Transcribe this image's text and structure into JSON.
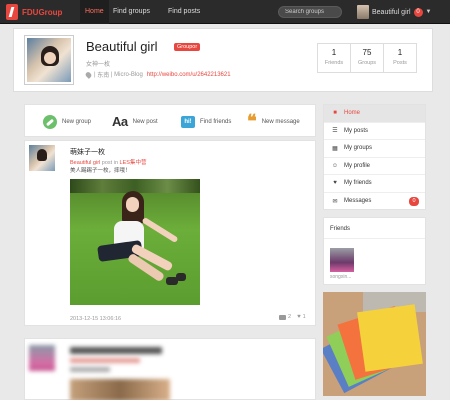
{
  "navbar": {
    "brand": "FDUGroup",
    "tabs": [
      {
        "label": "Home",
        "active": true
      },
      {
        "label": "Find groups",
        "active": false
      },
      {
        "label": "Find posts",
        "active": false
      }
    ],
    "search_placeholder": "Search groups",
    "user_name": "Beautiful girl",
    "notification_count": "0"
  },
  "profile": {
    "name": "Beautiful girl",
    "role_badge": "Groupor",
    "subtitle": "女神一枚",
    "location": "东南",
    "separator": "|",
    "microblog_label": "Micro-Blog",
    "microblog_url": "http://weibo.com/u/2642213621",
    "stats": [
      {
        "value": "1",
        "label": "Friends"
      },
      {
        "value": "75",
        "label": "Groups"
      },
      {
        "value": "1",
        "label": "Posts"
      }
    ]
  },
  "actions": [
    {
      "label": "New group",
      "icon": "group-icon"
    },
    {
      "label": "New post",
      "icon": "post-icon",
      "glyph": "Aa"
    },
    {
      "label": "Find friends",
      "icon": "find-friends-icon",
      "glyph": "hi!"
    },
    {
      "label": "New message",
      "icon": "message-icon",
      "glyph": "“"
    }
  ],
  "sidebar": {
    "items": [
      {
        "label": "Home",
        "icon": "home-icon",
        "glyph": "■",
        "active": true
      },
      {
        "label": "My posts",
        "icon": "posts-icon",
        "glyph": "☰",
        "active": false
      },
      {
        "label": "My groups",
        "icon": "groups-icon",
        "glyph": "▦",
        "active": false
      },
      {
        "label": "My profile",
        "icon": "profile-icon",
        "glyph": "☺",
        "active": false
      },
      {
        "label": "My friends",
        "icon": "friends-icon",
        "glyph": "♥",
        "active": false
      },
      {
        "label": "Messages",
        "icon": "messages-icon",
        "glyph": "✉",
        "active": false,
        "badge": "0"
      }
    ]
  },
  "friends": {
    "title": "Friends",
    "items": [
      {
        "name": "songxin..."
      }
    ]
  },
  "feed": {
    "post1": {
      "title": "萌妹子一枚",
      "author": "Beautiful girl",
      "meta_mid": " post in ",
      "group": "LES集中营",
      "body": "美人踢踢子一枚，摔哦！",
      "time": "2013-12-15 13:06:16",
      "comments": "2",
      "likes": "1"
    }
  },
  "colors": {
    "accent": "#e8473f",
    "navbar": "#2b2b2b",
    "page_bg": "#e9e9e9"
  }
}
